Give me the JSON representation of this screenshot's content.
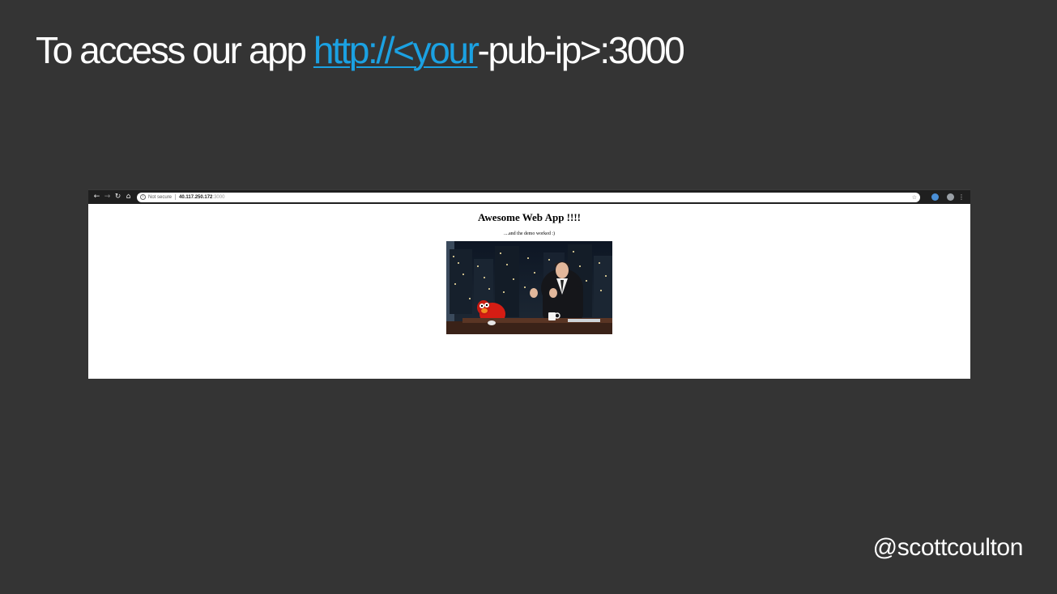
{
  "slide": {
    "title_prefix": "To access our app ",
    "title_link": "http://<your",
    "title_suffix": "-pub-ip>:3000",
    "footer_handle": "@scottcoulton",
    "colors": {
      "background": "#343434",
      "text": "#ffffff",
      "link": "#1ba1e2"
    }
  },
  "browser": {
    "nav_icons": [
      "back-arrow-icon",
      "forward-arrow-icon",
      "reload-icon",
      "home-icon"
    ],
    "security_label": "Not secure",
    "url_host": "40.117.250.172",
    "url_port": ":3000",
    "page": {
      "heading": "Awesome Web App !!!!",
      "subtext": "....and the demo worked :)"
    }
  }
}
